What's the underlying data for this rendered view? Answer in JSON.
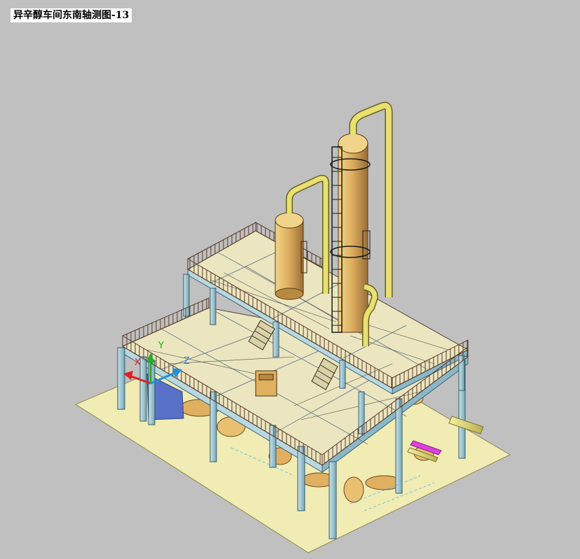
{
  "viewport": {
    "title": "异辛醇车间东南轴测图-13",
    "background_color": "#c0c0c0"
  },
  "ucs_icon": {
    "x_label": "X",
    "y_label": "Y",
    "z_label": "Z",
    "x_color": "#e02020",
    "y_color": "#20b020",
    "z_color": "#2090e0"
  },
  "colors": {
    "ground": "#f0ecb4",
    "deck": "#ece6c0",
    "column_steel": "#a8d0dc",
    "vessel_body": "#e8c070",
    "vessel_shade": "#b88a40",
    "pipe": "#e8e070",
    "railing": "#5a3a2a",
    "magenta_pipe": "#e040e0"
  }
}
